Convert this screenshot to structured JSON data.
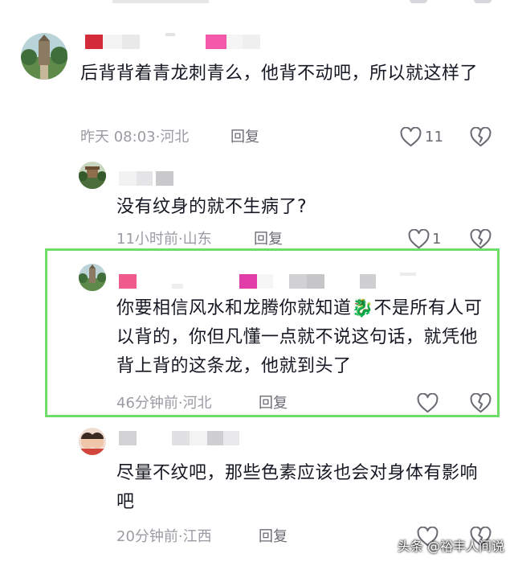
{
  "comments": [
    {
      "text": "后背背着青龙刺青么，他背不动吧，所以就这样了",
      "time": "昨天 08:03",
      "location": "河北",
      "reply_label": "回复",
      "likes": "11"
    },
    {
      "text": "没有纹身的就不生病了?",
      "time": "11小时前",
      "location": "山东",
      "reply_label": "回复",
      "likes": "1"
    },
    {
      "text": "你要相信风水和龙腾你就知道🐉不是所有人可以背的，你但凡懂一点就不说这句话，就凭他背上背的这条龙，他就到头了",
      "time": "46分钟前",
      "location": "河北",
      "reply_label": "回复",
      "likes": ""
    },
    {
      "text": "尽量不纹吧，那些色素应该也会对身体有影响吧",
      "time": "20分钟前",
      "location": "江西",
      "reply_label": "回复",
      "likes": ""
    }
  ],
  "meta_separator": "·",
  "watermark": "头条 @裕丰人间说",
  "colors": {
    "highlight_border": "#6fdd6a",
    "text": "#161823",
    "meta": "#9b9ca3"
  }
}
